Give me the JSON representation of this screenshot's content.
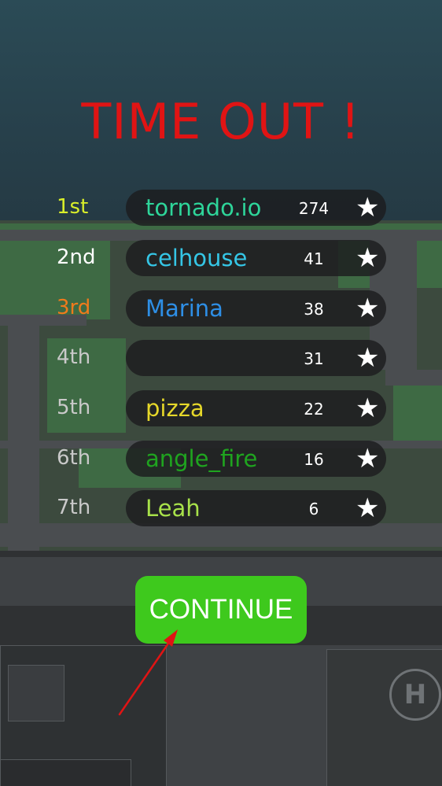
{
  "title": "TIME OUT !",
  "leaderboard": [
    {
      "rank": "1st",
      "rank_color": "#d9ee2a",
      "name": "tornado.io",
      "name_color": "#2ed59a",
      "score": "274"
    },
    {
      "rank": "2nd",
      "rank_color": "#ffffff",
      "name": "celhouse",
      "name_color": "#35c6e6",
      "score": "41"
    },
    {
      "rank": "3rd",
      "rank_color": "#f07a1c",
      "name": "Marina",
      "name_color": "#2e8fe6",
      "score": "38"
    },
    {
      "rank": "4th",
      "rank_color": "#c9c9c9",
      "name": "",
      "name_color": "#ffffff",
      "score": "31"
    },
    {
      "rank": "5th",
      "rank_color": "#c9c9c9",
      "name": "pizza",
      "name_color": "#e6d82a",
      "score": "22"
    },
    {
      "rank": "6th",
      "rank_color": "#c9c9c9",
      "name": "angle_fire",
      "name_color": "#1fa41f",
      "score": "16"
    },
    {
      "rank": "7th",
      "rank_color": "#c9c9c9",
      "name": "Leah",
      "name_color": "#a8e24a",
      "score": "6"
    }
  ],
  "continue_label": "CONTINUE",
  "icons": {
    "rank_badge": "star-icon",
    "pointer": "red-arrow-icon",
    "helipad": "H"
  },
  "colors": {
    "title": "#e01414",
    "continue_bg": "#3ec91d",
    "arrow": "#e01414"
  }
}
